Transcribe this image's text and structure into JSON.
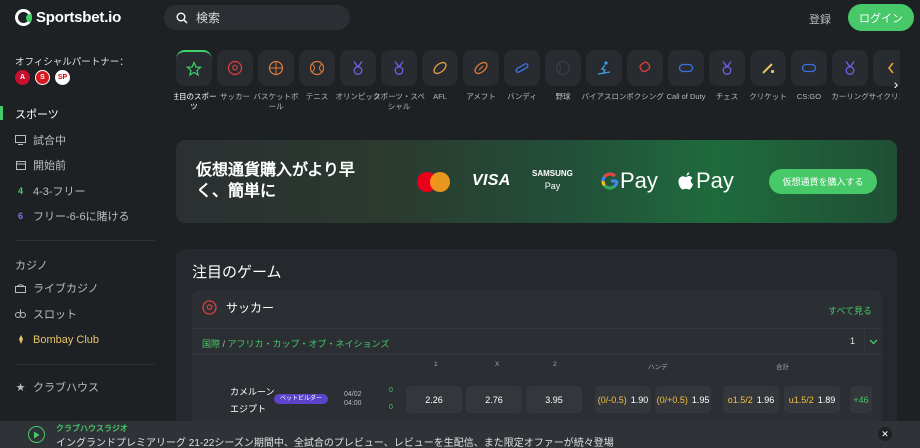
{
  "header": {
    "logo_text": "Sportsbet.io",
    "search_placeholder": "検索",
    "login_label": "登録",
    "register_label": "ログイン"
  },
  "sidebar": {
    "partner_title": "オフィシャルパートナー：",
    "partners": [
      "Arsenal",
      "Southampton",
      "São Paulo"
    ],
    "items": [
      {
        "label": "スポーツ",
        "icon": "none"
      },
      {
        "label": "試合中",
        "icon": "monitor-icon"
      },
      {
        "label": "開始前",
        "icon": "calendar-icon"
      },
      {
        "label": "4-3-フリー",
        "icon": "4"
      },
      {
        "label": "フリー-6-6に賭ける",
        "icon": "6"
      }
    ],
    "casino_head": "カジノ",
    "casino_items": [
      {
        "label": "ライブカジノ",
        "icon": "live-casino-icon"
      },
      {
        "label": "スロット",
        "icon": "slot-icon"
      },
      {
        "label": "Bombay Club",
        "icon": "lamp-icon"
      }
    ],
    "club_item": {
      "label": "クラブハウス",
      "icon": "star-icon"
    }
  },
  "sports": [
    {
      "label": "注目のスポーツ",
      "icon": "star-icon"
    },
    {
      "label": "サッカー",
      "icon": "soccer-icon"
    },
    {
      "label": "バスケットボール",
      "icon": "basketball-icon"
    },
    {
      "label": "テニス",
      "icon": "tennis-icon"
    },
    {
      "label": "オリンピック",
      "icon": "medal-icon"
    },
    {
      "label": "スポーツ・スペシャル",
      "icon": "medal-icon"
    },
    {
      "label": "AFL",
      "icon": "afl-ball-icon"
    },
    {
      "label": "アメフト",
      "icon": "football-icon"
    },
    {
      "label": "バンディ",
      "icon": "bandy-icon"
    },
    {
      "label": "野球",
      "icon": "baseball-icon"
    },
    {
      "label": "バイアスロン",
      "icon": "biathlon-icon"
    },
    {
      "label": "ボクシング",
      "icon": "boxing-icon"
    },
    {
      "label": "Call of Duty",
      "icon": "gamepad-icon"
    },
    {
      "label": "チェス",
      "icon": "medal-icon"
    },
    {
      "label": "クリケット",
      "icon": "cricket-icon"
    },
    {
      "label": "CS:GO",
      "icon": "gamepad-icon"
    },
    {
      "label": "カーリング",
      "icon": "medal-icon"
    },
    {
      "label": "サイクリング",
      "icon": "cycling-icon"
    }
  ],
  "banner": {
    "text": "仮想通貨購入がより早く、簡単に",
    "visa": "VISA",
    "samsung_line1": "SAMSUNG",
    "samsung_line2": "Pay",
    "gpay": "Pay",
    "applepay": "Pay",
    "buy_button": "仮想通貨を購入する"
  },
  "featured": {
    "title": "注目のゲーム",
    "sport_name": "サッカー",
    "see_all": "すべて見る",
    "league_country": "国際",
    "league_name": "アフリカ・カップ・オブ・ネイションズ",
    "league_count": "1",
    "col_1": "1",
    "col_x": "X",
    "col_2": "2",
    "col_handicap": "ハンデ",
    "col_total": "合計",
    "match": {
      "home": "カメルーン",
      "away": "エジプト",
      "badge": "ベットビルダー",
      "date": "04/02",
      "time": "04:00",
      "score_home": "0",
      "score_away": "0",
      "odd_1": "2.26",
      "odd_x": "2.76",
      "odd_2": "3.95",
      "hc_home_line": "(0/-0.5)",
      "hc_home_odd": "1.90",
      "hc_away_line": "(0/+0.5)",
      "hc_away_odd": "1.95",
      "over_line": "o1.5/2",
      "over_odd": "1.96",
      "under_line": "u1.5/2",
      "under_odd": "1.89",
      "more": "+46"
    }
  },
  "radio": {
    "title": "クラブハウスラジオ",
    "text": "イングランドプレミアリーグ 21-22シーズン期間中、全試合のプレビュー、レビューを生配信、また限定オファーが続々登場"
  },
  "colors": {
    "accent": "#47c96a",
    "background": "#1e2124",
    "panel": "#25292d",
    "badge": "#5b44c9",
    "handicap": "#f5c042"
  }
}
